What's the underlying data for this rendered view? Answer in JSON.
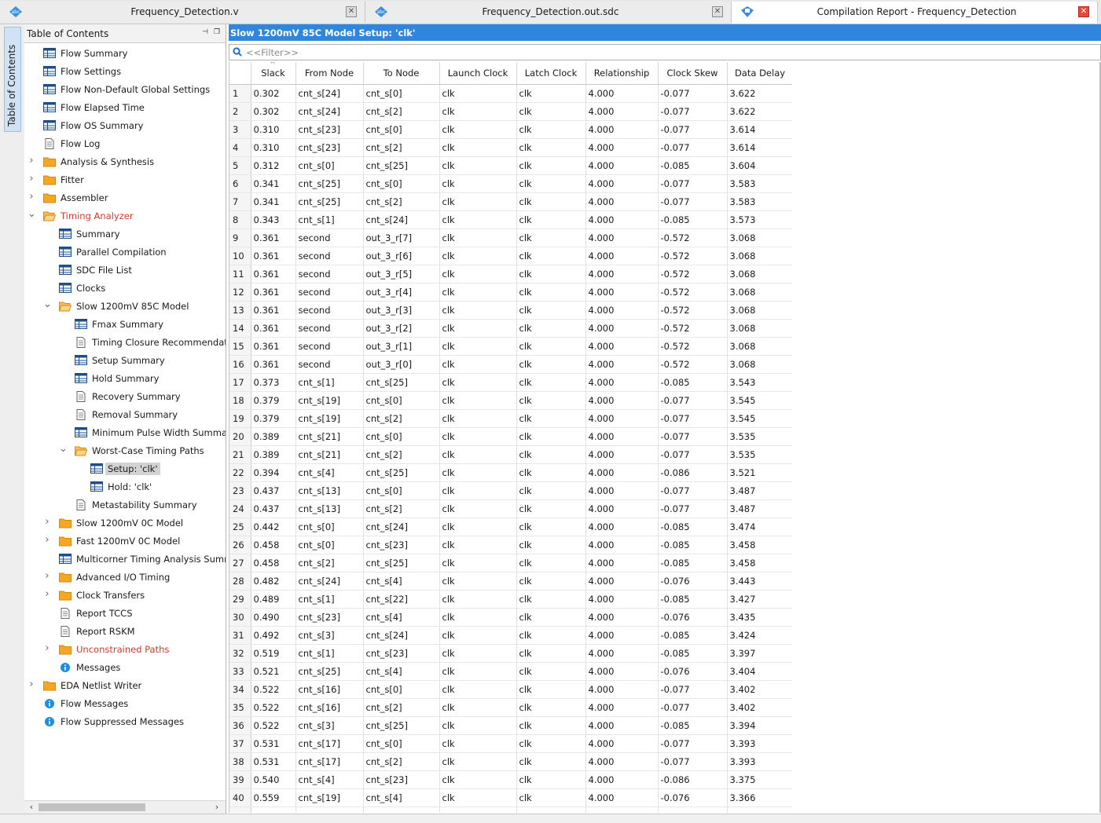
{
  "tabs": [
    {
      "label": "Frequency_Detection.v",
      "active": false,
      "icon": "verilog-file-icon"
    },
    {
      "label": "Frequency_Detection.out.sdc",
      "active": false,
      "icon": "sdc-file-icon"
    },
    {
      "label": "Compilation Report - Frequency_Detection",
      "active": true,
      "icon": "compilation-report-icon"
    }
  ],
  "side_tab": {
    "label": "Table of Contents"
  },
  "toc": {
    "title": "Table of Contents",
    "items": [
      {
        "label": "Flow Summary",
        "icon": "table",
        "level": 0,
        "arrow": ""
      },
      {
        "label": "Flow Settings",
        "icon": "table",
        "level": 0,
        "arrow": ""
      },
      {
        "label": "Flow Non-Default Global Settings",
        "icon": "table",
        "level": 0,
        "arrow": ""
      },
      {
        "label": "Flow Elapsed Time",
        "icon": "table",
        "level": 0,
        "arrow": ""
      },
      {
        "label": "Flow OS Summary",
        "icon": "table",
        "level": 0,
        "arrow": ""
      },
      {
        "label": "Flow Log",
        "icon": "doc",
        "level": 0,
        "arrow": ""
      },
      {
        "label": "Analysis & Synthesis",
        "icon": "folder",
        "level": 0,
        "arrow": "collapsed"
      },
      {
        "label": "Fitter",
        "icon": "folder",
        "level": 0,
        "arrow": "collapsed"
      },
      {
        "label": "Assembler",
        "icon": "folder",
        "level": 0,
        "arrow": "collapsed"
      },
      {
        "label": "Timing Analyzer",
        "icon": "folder-open",
        "level": 0,
        "arrow": "expanded",
        "red": true
      },
      {
        "label": "Summary",
        "icon": "table",
        "level": 1,
        "arrow": ""
      },
      {
        "label": "Parallel Compilation",
        "icon": "table",
        "level": 1,
        "arrow": ""
      },
      {
        "label": "SDC File List",
        "icon": "table",
        "level": 1,
        "arrow": ""
      },
      {
        "label": "Clocks",
        "icon": "table",
        "level": 1,
        "arrow": ""
      },
      {
        "label": "Slow 1200mV 85C Model",
        "icon": "folder-open",
        "level": 1,
        "arrow": "expanded"
      },
      {
        "label": "Fmax Summary",
        "icon": "table",
        "level": 2,
        "arrow": ""
      },
      {
        "label": "Timing Closure Recommendations",
        "icon": "doc",
        "level": 2,
        "arrow": ""
      },
      {
        "label": "Setup Summary",
        "icon": "table",
        "level": 2,
        "arrow": ""
      },
      {
        "label": "Hold Summary",
        "icon": "table",
        "level": 2,
        "arrow": ""
      },
      {
        "label": "Recovery Summary",
        "icon": "doc",
        "level": 2,
        "arrow": ""
      },
      {
        "label": "Removal Summary",
        "icon": "doc",
        "level": 2,
        "arrow": ""
      },
      {
        "label": "Minimum Pulse Width Summary",
        "icon": "table",
        "level": 2,
        "arrow": ""
      },
      {
        "label": "Worst-Case Timing Paths",
        "icon": "folder-open",
        "level": 2,
        "arrow": "expanded"
      },
      {
        "label": "Setup: 'clk'",
        "icon": "table",
        "level": 3,
        "arrow": "",
        "selected": true
      },
      {
        "label": "Hold: 'clk'",
        "icon": "table",
        "level": 3,
        "arrow": ""
      },
      {
        "label": "Metastability Summary",
        "icon": "doc",
        "level": 2,
        "arrow": ""
      },
      {
        "label": "Slow 1200mV 0C Model",
        "icon": "folder",
        "level": 1,
        "arrow": "collapsed"
      },
      {
        "label": "Fast 1200mV 0C Model",
        "icon": "folder",
        "level": 1,
        "arrow": "collapsed"
      },
      {
        "label": "Multicorner Timing Analysis Summary",
        "icon": "table",
        "level": 1,
        "arrow": ""
      },
      {
        "label": "Advanced I/O Timing",
        "icon": "folder",
        "level": 1,
        "arrow": "collapsed"
      },
      {
        "label": "Clock Transfers",
        "icon": "folder",
        "level": 1,
        "arrow": "collapsed"
      },
      {
        "label": "Report TCCS",
        "icon": "doc",
        "level": 1,
        "arrow": ""
      },
      {
        "label": "Report RSKM",
        "icon": "doc",
        "level": 1,
        "arrow": ""
      },
      {
        "label": "Unconstrained Paths",
        "icon": "folder",
        "level": 1,
        "arrow": "collapsed",
        "red": true
      },
      {
        "label": "Messages",
        "icon": "info",
        "level": 1,
        "arrow": ""
      },
      {
        "label": "EDA Netlist Writer",
        "icon": "folder",
        "level": 0,
        "arrow": "collapsed"
      },
      {
        "label": "Flow Messages",
        "icon": "info",
        "level": 0,
        "arrow": ""
      },
      {
        "label": "Flow Suppressed Messages",
        "icon": "info",
        "level": 0,
        "arrow": ""
      }
    ]
  },
  "report": {
    "title": "Slow 1200mV 85C Model Setup: 'clk'",
    "filter_placeholder": "<<Filter>>",
    "columns": [
      "",
      "Slack",
      "From Node",
      "To Node",
      "Launch Clock",
      "Latch Clock",
      "Relationship",
      "Clock Skew",
      "Data Delay"
    ],
    "rows": [
      [
        "1",
        "0.302",
        "cnt_s[24]",
        "cnt_s[0]",
        "clk",
        "clk",
        "4.000",
        "-0.077",
        "3.622"
      ],
      [
        "2",
        "0.302",
        "cnt_s[24]",
        "cnt_s[2]",
        "clk",
        "clk",
        "4.000",
        "-0.077",
        "3.622"
      ],
      [
        "3",
        "0.310",
        "cnt_s[23]",
        "cnt_s[0]",
        "clk",
        "clk",
        "4.000",
        "-0.077",
        "3.614"
      ],
      [
        "4",
        "0.310",
        "cnt_s[23]",
        "cnt_s[2]",
        "clk",
        "clk",
        "4.000",
        "-0.077",
        "3.614"
      ],
      [
        "5",
        "0.312",
        "cnt_s[0]",
        "cnt_s[25]",
        "clk",
        "clk",
        "4.000",
        "-0.085",
        "3.604"
      ],
      [
        "6",
        "0.341",
        "cnt_s[25]",
        "cnt_s[0]",
        "clk",
        "clk",
        "4.000",
        "-0.077",
        "3.583"
      ],
      [
        "7",
        "0.341",
        "cnt_s[25]",
        "cnt_s[2]",
        "clk",
        "clk",
        "4.000",
        "-0.077",
        "3.583"
      ],
      [
        "8",
        "0.343",
        "cnt_s[1]",
        "cnt_s[24]",
        "clk",
        "clk",
        "4.000",
        "-0.085",
        "3.573"
      ],
      [
        "9",
        "0.361",
        "second",
        "out_3_r[7]",
        "clk",
        "clk",
        "4.000",
        "-0.572",
        "3.068"
      ],
      [
        "10",
        "0.361",
        "second",
        "out_3_r[6]",
        "clk",
        "clk",
        "4.000",
        "-0.572",
        "3.068"
      ],
      [
        "11",
        "0.361",
        "second",
        "out_3_r[5]",
        "clk",
        "clk",
        "4.000",
        "-0.572",
        "3.068"
      ],
      [
        "12",
        "0.361",
        "second",
        "out_3_r[4]",
        "clk",
        "clk",
        "4.000",
        "-0.572",
        "3.068"
      ],
      [
        "13",
        "0.361",
        "second",
        "out_3_r[3]",
        "clk",
        "clk",
        "4.000",
        "-0.572",
        "3.068"
      ],
      [
        "14",
        "0.361",
        "second",
        "out_3_r[2]",
        "clk",
        "clk",
        "4.000",
        "-0.572",
        "3.068"
      ],
      [
        "15",
        "0.361",
        "second",
        "out_3_r[1]",
        "clk",
        "clk",
        "4.000",
        "-0.572",
        "3.068"
      ],
      [
        "16",
        "0.361",
        "second",
        "out_3_r[0]",
        "clk",
        "clk",
        "4.000",
        "-0.572",
        "3.068"
      ],
      [
        "17",
        "0.373",
        "cnt_s[1]",
        "cnt_s[25]",
        "clk",
        "clk",
        "4.000",
        "-0.085",
        "3.543"
      ],
      [
        "18",
        "0.379",
        "cnt_s[19]",
        "cnt_s[0]",
        "clk",
        "clk",
        "4.000",
        "-0.077",
        "3.545"
      ],
      [
        "19",
        "0.379",
        "cnt_s[19]",
        "cnt_s[2]",
        "clk",
        "clk",
        "4.000",
        "-0.077",
        "3.545"
      ],
      [
        "20",
        "0.389",
        "cnt_s[21]",
        "cnt_s[0]",
        "clk",
        "clk",
        "4.000",
        "-0.077",
        "3.535"
      ],
      [
        "21",
        "0.389",
        "cnt_s[21]",
        "cnt_s[2]",
        "clk",
        "clk",
        "4.000",
        "-0.077",
        "3.535"
      ],
      [
        "22",
        "0.394",
        "cnt_s[4]",
        "cnt_s[25]",
        "clk",
        "clk",
        "4.000",
        "-0.086",
        "3.521"
      ],
      [
        "23",
        "0.437",
        "cnt_s[13]",
        "cnt_s[0]",
        "clk",
        "clk",
        "4.000",
        "-0.077",
        "3.487"
      ],
      [
        "24",
        "0.437",
        "cnt_s[13]",
        "cnt_s[2]",
        "clk",
        "clk",
        "4.000",
        "-0.077",
        "3.487"
      ],
      [
        "25",
        "0.442",
        "cnt_s[0]",
        "cnt_s[24]",
        "clk",
        "clk",
        "4.000",
        "-0.085",
        "3.474"
      ],
      [
        "26",
        "0.458",
        "cnt_s[0]",
        "cnt_s[23]",
        "clk",
        "clk",
        "4.000",
        "-0.085",
        "3.458"
      ],
      [
        "27",
        "0.458",
        "cnt_s[2]",
        "cnt_s[25]",
        "clk",
        "clk",
        "4.000",
        "-0.085",
        "3.458"
      ],
      [
        "28",
        "0.482",
        "cnt_s[24]",
        "cnt_s[4]",
        "clk",
        "clk",
        "4.000",
        "-0.076",
        "3.443"
      ],
      [
        "29",
        "0.489",
        "cnt_s[1]",
        "cnt_s[22]",
        "clk",
        "clk",
        "4.000",
        "-0.085",
        "3.427"
      ],
      [
        "30",
        "0.490",
        "cnt_s[23]",
        "cnt_s[4]",
        "clk",
        "clk",
        "4.000",
        "-0.076",
        "3.435"
      ],
      [
        "31",
        "0.492",
        "cnt_s[3]",
        "cnt_s[24]",
        "clk",
        "clk",
        "4.000",
        "-0.085",
        "3.424"
      ],
      [
        "32",
        "0.519",
        "cnt_s[1]",
        "cnt_s[23]",
        "clk",
        "clk",
        "4.000",
        "-0.085",
        "3.397"
      ],
      [
        "33",
        "0.521",
        "cnt_s[25]",
        "cnt_s[4]",
        "clk",
        "clk",
        "4.000",
        "-0.076",
        "3.404"
      ],
      [
        "34",
        "0.522",
        "cnt_s[16]",
        "cnt_s[0]",
        "clk",
        "clk",
        "4.000",
        "-0.077",
        "3.402"
      ],
      [
        "35",
        "0.522",
        "cnt_s[16]",
        "cnt_s[2]",
        "clk",
        "clk",
        "4.000",
        "-0.077",
        "3.402"
      ],
      [
        "36",
        "0.522",
        "cnt_s[3]",
        "cnt_s[25]",
        "clk",
        "clk",
        "4.000",
        "-0.085",
        "3.394"
      ],
      [
        "37",
        "0.531",
        "cnt_s[17]",
        "cnt_s[0]",
        "clk",
        "clk",
        "4.000",
        "-0.077",
        "3.393"
      ],
      [
        "38",
        "0.531",
        "cnt_s[17]",
        "cnt_s[2]",
        "clk",
        "clk",
        "4.000",
        "-0.077",
        "3.393"
      ],
      [
        "39",
        "0.540",
        "cnt_s[4]",
        "cnt_s[23]",
        "clk",
        "clk",
        "4.000",
        "-0.086",
        "3.375"
      ],
      [
        "40",
        "0.559",
        "cnt_s[19]",
        "cnt_s[4]",
        "clk",
        "clk",
        "4.000",
        "-0.076",
        "3.366"
      ]
    ]
  },
  "colors": {
    "title_bar": "#2f86dc",
    "red_item": "#d43a2a",
    "folder": "#f5a623",
    "info": "#1e8fe0",
    "close_active": "#e84a3a"
  }
}
